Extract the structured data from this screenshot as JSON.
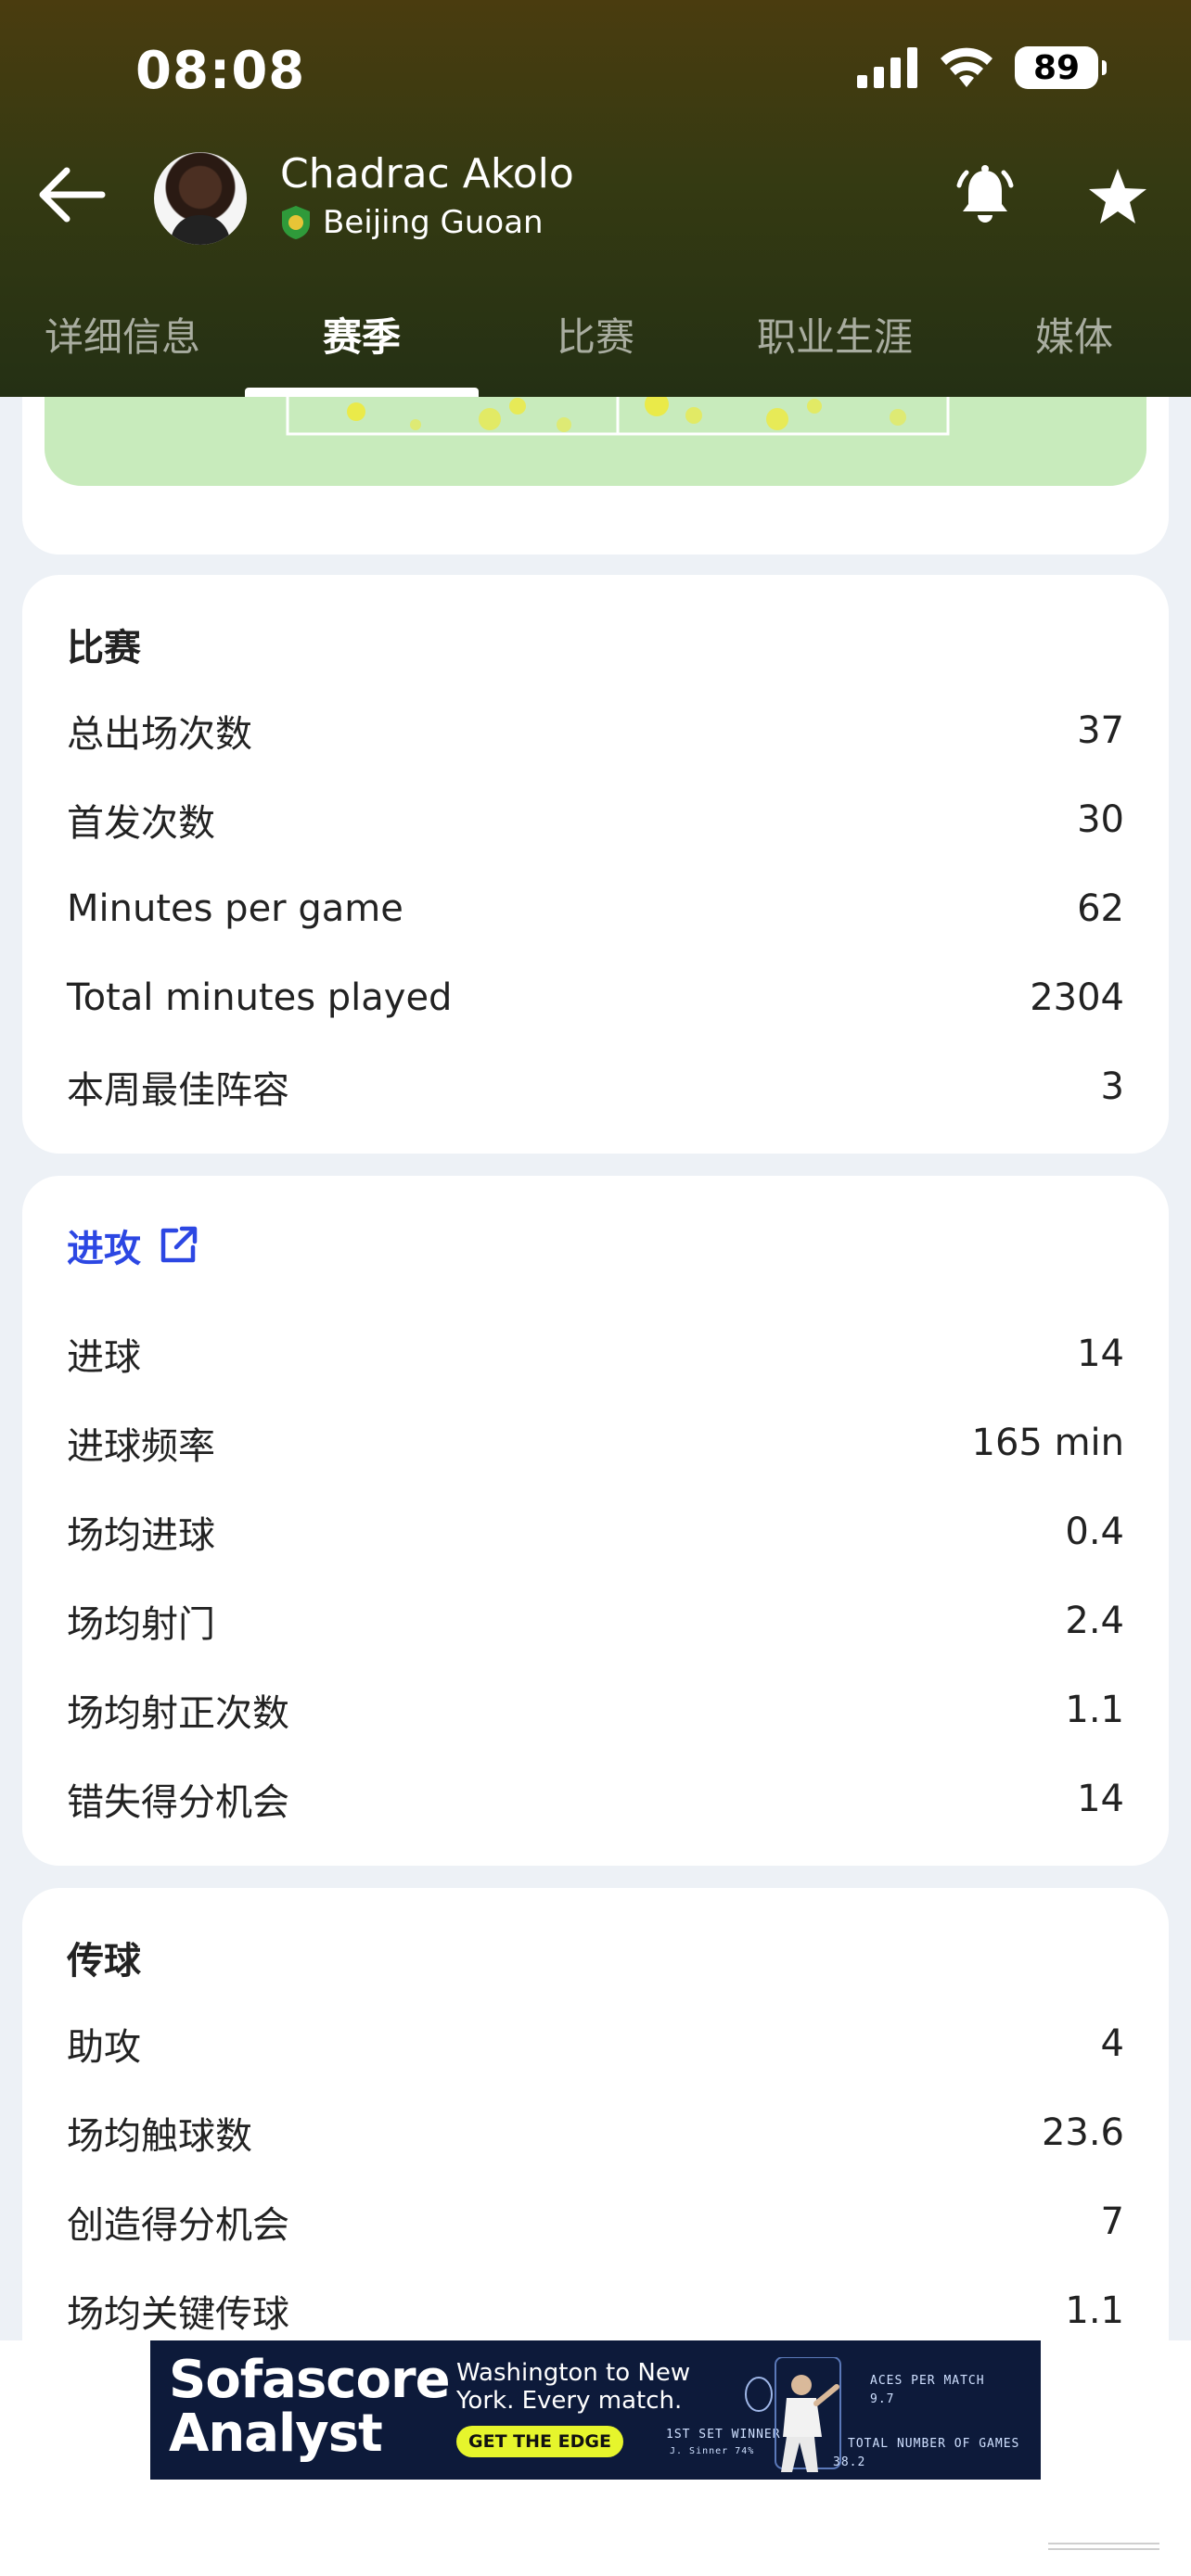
{
  "status_bar": {
    "time": "08:08",
    "battery": "89"
  },
  "header": {
    "player_name": "Chadrac Akolo",
    "team_name": "Beijing Guoan",
    "tabs": [
      {
        "label": "详细信息",
        "active": false
      },
      {
        "label": "赛季",
        "active": true
      },
      {
        "label": "比赛",
        "active": false
      },
      {
        "label": "职业生涯",
        "active": false
      },
      {
        "label": "媒体",
        "active": false
      }
    ]
  },
  "sections": {
    "matches": {
      "title": "比赛",
      "rows": [
        {
          "label": "总出场次数",
          "value": "37"
        },
        {
          "label": "首发次数",
          "value": "30"
        },
        {
          "label": "Minutes per game",
          "value": "62"
        },
        {
          "label": "Total minutes played",
          "value": "2304"
        },
        {
          "label": "本周最佳阵容",
          "value": "3"
        }
      ]
    },
    "attack": {
      "title": "进攻",
      "rows": [
        {
          "label": "进球",
          "value": "14"
        },
        {
          "label": "进球频率",
          "value": "165 min"
        },
        {
          "label": "场均进球",
          "value": "0.4"
        },
        {
          "label": "场均射门",
          "value": "2.4"
        },
        {
          "label": "场均射正次数",
          "value": "1.1"
        },
        {
          "label": "错失得分机会",
          "value": "14"
        }
      ]
    },
    "passing": {
      "title": "传球",
      "rows": [
        {
          "label": "助攻",
          "value": "4"
        },
        {
          "label": "场均触球数",
          "value": "23.6"
        },
        {
          "label": "创造得分机会",
          "value": "7"
        },
        {
          "label": "场均关键传球",
          "value": "1.1"
        }
      ]
    }
  },
  "ad": {
    "brand_line1": "Sofascore",
    "brand_line2": "Analyst",
    "headline_line1": "Washington to New",
    "headline_line2": "York. Every match.",
    "cta": "GET THE EDGE",
    "stat_aces": "ACES PER MATCH",
    "stat_aces_value": "9.7",
    "stat_winner": "1ST SET WINNER",
    "stat_winner_sub": "J. Sinner 74%",
    "stat_games": "TOTAL NUMBER OF GAMES",
    "stat_games_value": "38.2"
  },
  "colors": {
    "accent": "#2c47e3",
    "header_top": "#4a3c0f",
    "header_bottom": "#243014",
    "pitch": "#c8ebbc",
    "page_bg": "#edf1f6"
  }
}
